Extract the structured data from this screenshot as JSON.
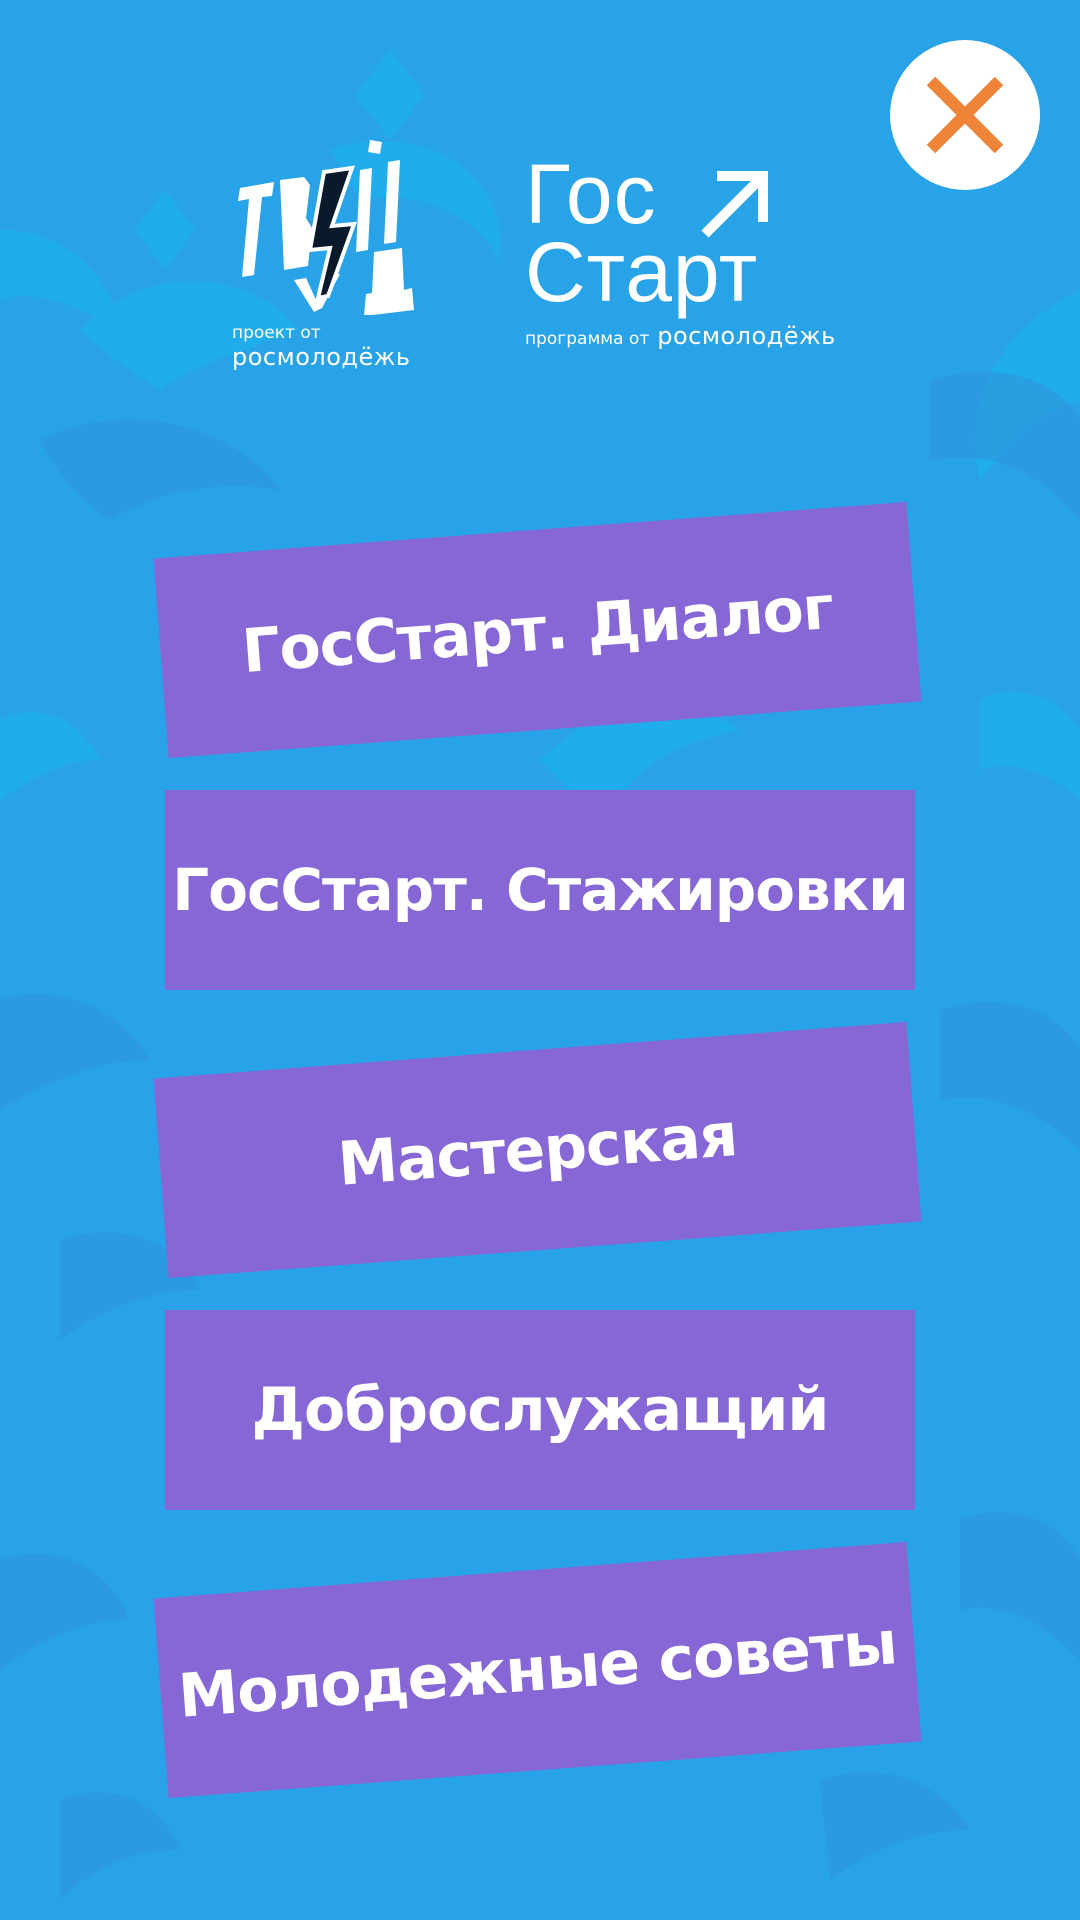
{
  "colors": {
    "background": "#29a3e8",
    "ornament_light": "#17b6ee",
    "ornament_dark": "#2e94d8",
    "button": "#8766d6",
    "close_icon": "#ef8337",
    "logo_accent": "#0a1a2a"
  },
  "header": {
    "close_icon": "close-icon",
    "tvoy_hod": {
      "wordmark": "ТВОЙ ХОД",
      "caption": "проект от",
      "brand": "росмолодёжь"
    },
    "gos_start": {
      "line1": "Гос",
      "line2": "Старт",
      "caption": "программа от",
      "brand": "росмолодёжь"
    }
  },
  "menu": {
    "items": [
      {
        "label": "ГосСтарт. Диалог"
      },
      {
        "label": "ГосСтарт. Стажировки"
      },
      {
        "label": "Мастерская"
      },
      {
        "label": "Доброслужащий"
      },
      {
        "label": "Молодежные советы"
      }
    ]
  }
}
